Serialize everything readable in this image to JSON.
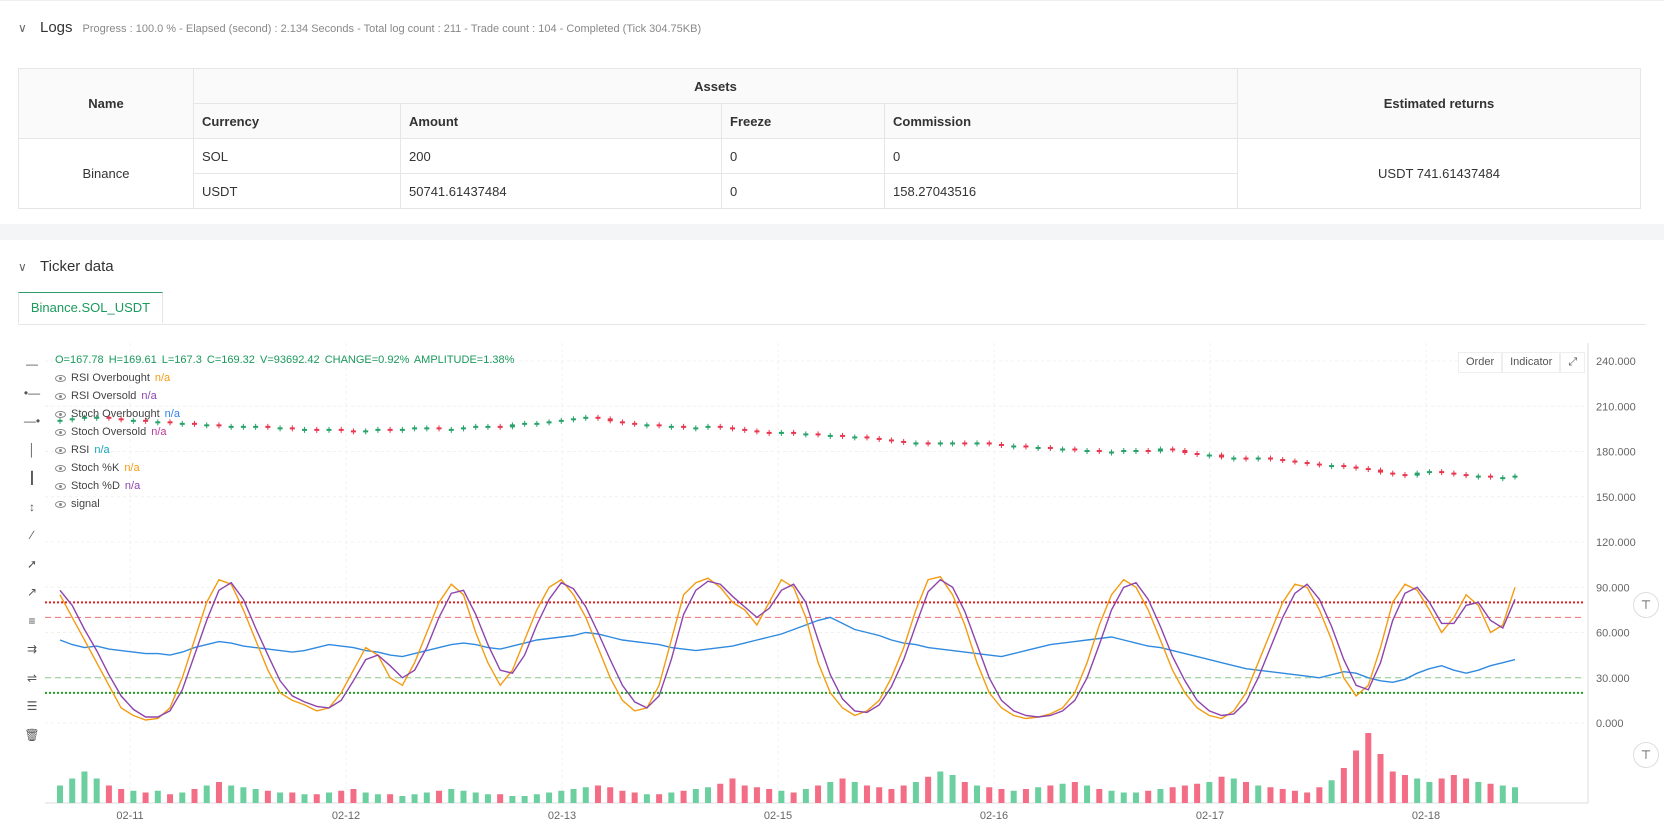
{
  "logs": {
    "title": "Logs",
    "meta": "Progress : 100.0 % - Elapsed (second) : 2.134  Seconds - Total log count : 211 - Trade count : 104 - Completed (Tick 304.75KB)",
    "table": {
      "h_name": "Name",
      "h_assets": "Assets",
      "h_returns": "Estimated returns",
      "h_currency": "Currency",
      "h_amount": "Amount",
      "h_freeze": "Freeze",
      "h_commission": "Commission",
      "exchange": "Binance",
      "rows": [
        {
          "currency": "SOL",
          "amount": "200",
          "freeze": "0",
          "commission": "0"
        },
        {
          "currency": "USDT",
          "amount": "50741.61437484",
          "freeze": "0",
          "commission": "158.27043516"
        }
      ],
      "returns": "USDT 741.61437484"
    }
  },
  "ticker": {
    "title": "Ticker data",
    "tab": "Binance.SOL_USDT",
    "buttons": {
      "order": "Order",
      "indicator": "Indicator"
    },
    "ohlc": {
      "o": "O=167.78",
      "h": "H=169.61",
      "l": "L=167.3",
      "c": "C=169.32",
      "v": "V=93692.42",
      "change": "CHANGE=0.92%",
      "amplitude": "AMPLITUDE=1.38%"
    },
    "legend": [
      {
        "name": "RSI Overbought",
        "value": "n/a",
        "color": "#f39c12"
      },
      {
        "name": "RSI Oversold",
        "value": "n/a",
        "color": "#8e44ad"
      },
      {
        "name": "Stoch Overbought",
        "value": "n/a",
        "color": "#2f80ed"
      },
      {
        "name": "Stoch Oversold",
        "value": "n/a",
        "color": "#c0399b"
      },
      {
        "name": "RSI",
        "value": "n/a",
        "color": "#16a5b8"
      },
      {
        "name": "Stoch %K",
        "value": "n/a",
        "color": "#f39c12"
      },
      {
        "name": "Stoch %D",
        "value": "n/a",
        "color": "#8e44ad"
      },
      {
        "name": "signal",
        "value": "",
        "color": "#444444"
      }
    ]
  },
  "chart_data": {
    "type": "line",
    "x_ticks": [
      "02-11",
      "02-12",
      "02-13",
      "02-15",
      "02-16",
      "02-17",
      "02-18"
    ],
    "y_ticks": [
      "240.000",
      "210.000",
      "180.000",
      "150.000",
      "120.000",
      "90.000",
      "60.000",
      "30.000",
      "0.000"
    ],
    "ylim": [
      0,
      240
    ],
    "price_close": [
      201,
      202,
      203,
      203,
      202,
      201,
      201,
      200,
      200,
      199,
      199,
      198,
      198,
      197,
      197,
      197,
      197,
      196,
      196,
      195,
      195,
      194,
      195,
      194,
      193,
      194,
      195,
      194,
      195,
      196,
      196,
      195,
      195,
      196,
      197,
      197,
      196,
      198,
      199,
      199,
      200,
      201,
      202,
      203,
      202,
      200,
      199,
      198,
      198,
      197,
      197,
      196,
      196,
      197,
      196,
      195,
      194,
      193,
      192,
      193,
      192,
      192,
      191,
      191,
      190,
      190,
      189,
      188,
      187,
      186,
      186,
      185,
      186,
      186,
      185,
      186,
      185,
      184,
      184,
      183,
      183,
      182,
      182,
      181,
      181,
      180,
      180,
      181,
      181,
      180,
      182,
      181,
      179,
      178,
      178,
      176,
      176,
      175,
      176,
      175,
      174,
      173,
      172,
      171,
      171,
      170,
      169,
      168,
      166,
      165,
      164,
      166,
      167,
      166,
      165,
      164,
      164,
      163,
      163,
      164
    ],
    "rsi": [
      55,
      52,
      50,
      51,
      49,
      48,
      47,
      46,
      46,
      45,
      47,
      50,
      52,
      54,
      53,
      51,
      50,
      49,
      48,
      47,
      48,
      50,
      52,
      51,
      50,
      48,
      47,
      45,
      44,
      46,
      48,
      50,
      52,
      53,
      52,
      50,
      49,
      51,
      53,
      55,
      56,
      57,
      58,
      60,
      59,
      57,
      55,
      54,
      53,
      52,
      50,
      49,
      48,
      49,
      50,
      51,
      53,
      55,
      57,
      59,
      62,
      65,
      68,
      70,
      66,
      62,
      60,
      58,
      55,
      53,
      52,
      50,
      49,
      48,
      47,
      46,
      45,
      44,
      46,
      48,
      50,
      52,
      53,
      54,
      55,
      56,
      57,
      55,
      53,
      51,
      50,
      48,
      46,
      44,
      42,
      40,
      38,
      36,
      35,
      34,
      33,
      32,
      31,
      30,
      32,
      34,
      33,
      30,
      28,
      27,
      29,
      33,
      36,
      38,
      35,
      33,
      35,
      38,
      40,
      42
    ],
    "stoch_k": [
      85,
      70,
      55,
      40,
      25,
      10,
      5,
      2,
      3,
      10,
      30,
      55,
      80,
      95,
      92,
      75,
      55,
      35,
      20,
      15,
      12,
      8,
      10,
      20,
      35,
      50,
      45,
      30,
      25,
      40,
      60,
      80,
      92,
      85,
      60,
      40,
      25,
      35,
      55,
      75,
      90,
      95,
      85,
      70,
      50,
      30,
      15,
      8,
      10,
      25,
      55,
      85,
      93,
      96,
      90,
      80,
      75,
      65,
      80,
      95,
      90,
      70,
      40,
      20,
      10,
      5,
      8,
      15,
      30,
      50,
      75,
      95,
      97,
      85,
      65,
      40,
      20,
      10,
      5,
      3,
      4,
      6,
      10,
      20,
      40,
      65,
      85,
      95,
      90,
      75,
      55,
      35,
      20,
      10,
      5,
      3,
      8,
      20,
      40,
      60,
      80,
      92,
      90,
      75,
      55,
      30,
      18,
      25,
      50,
      80,
      92,
      88,
      75,
      60,
      70,
      85,
      78,
      60,
      65,
      90
    ],
    "stoch_d": [
      88,
      78,
      62,
      48,
      32,
      18,
      9,
      4,
      4,
      8,
      22,
      45,
      68,
      88,
      93,
      82,
      63,
      45,
      28,
      18,
      14,
      11,
      10,
      15,
      28,
      42,
      45,
      38,
      30,
      35,
      50,
      70,
      86,
      88,
      72,
      52,
      35,
      33,
      45,
      65,
      82,
      93,
      89,
      77,
      60,
      42,
      25,
      14,
      10,
      18,
      42,
      72,
      88,
      94,
      92,
      84,
      77,
      70,
      76,
      88,
      92,
      80,
      55,
      32,
      16,
      8,
      7,
      12,
      24,
      42,
      65,
      87,
      95,
      90,
      74,
      52,
      30,
      15,
      8,
      5,
      4,
      5,
      8,
      15,
      30,
      52,
      75,
      90,
      93,
      82,
      64,
      44,
      28,
      15,
      8,
      5,
      6,
      14,
      30,
      50,
      70,
      86,
      92,
      82,
      64,
      42,
      25,
      22,
      40,
      68,
      86,
      90,
      80,
      66,
      66,
      78,
      80,
      68,
      63,
      82
    ],
    "volume": [
      10,
      14,
      18,
      14,
      10,
      8,
      7,
      6,
      7,
      5,
      6,
      8,
      10,
      12,
      10,
      9,
      8,
      7,
      6,
      6,
      5,
      5,
      6,
      7,
      8,
      6,
      5,
      5,
      4,
      5,
      6,
      7,
      8,
      7,
      6,
      5,
      5,
      4,
      4,
      5,
      6,
      7,
      8,
      9,
      10,
      9,
      7,
      6,
      5,
      5,
      6,
      7,
      8,
      9,
      11,
      14,
      10,
      9,
      8,
      7,
      6,
      8,
      10,
      12,
      14,
      12,
      10,
      9,
      8,
      10,
      12,
      15,
      18,
      16,
      12,
      10,
      9,
      8,
      7,
      8,
      9,
      10,
      11,
      12,
      10,
      8,
      7,
      6,
      6,
      7,
      8,
      9,
      10,
      11,
      12,
      15,
      14,
      12,
      10,
      9,
      8,
      7,
      6,
      9,
      13,
      20,
      30,
      40,
      28,
      18,
      16,
      14,
      12,
      14,
      16,
      14,
      12,
      11,
      10,
      9
    ],
    "rsi_overbought": 70,
    "rsi_oversold": 30,
    "stoch_overbought": 80,
    "stoch_oversold": 20
  }
}
